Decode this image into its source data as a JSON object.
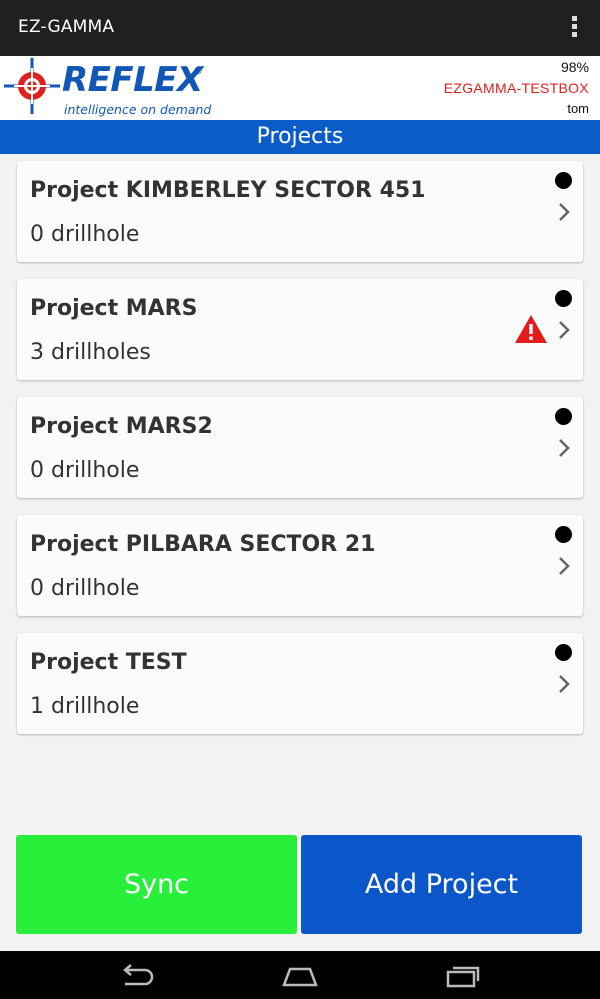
{
  "app": {
    "title": "EZ-GAMMA"
  },
  "brand": {
    "logo_word": "REFLEX",
    "logo_reg": "®",
    "tagline": "intelligence on demand",
    "battery": "98%",
    "device": "EZGAMMA-TESTBOX",
    "user": "tom",
    "colors": {
      "brand_blue": "#1057b6",
      "device_red": "#e0201c"
    }
  },
  "page": {
    "title": "Projects"
  },
  "projects": [
    {
      "name": "Project KIMBERLEY SECTOR 451",
      "count": "0 drillhole",
      "warning": false
    },
    {
      "name": "Project MARS",
      "count": "3 drillholes",
      "warning": true
    },
    {
      "name": "Project MARS2",
      "count": "0 drillhole",
      "warning": false
    },
    {
      "name": "Project PILBARA SECTOR 21",
      "count": "0 drillhole",
      "warning": false
    },
    {
      "name": "Project TEST",
      "count": "1 drillhole",
      "warning": false
    }
  ],
  "buttons": {
    "sync": "Sync",
    "add": "Add Project"
  },
  "colors": {
    "sync": "#28f03a",
    "add": "#0b56c9",
    "titlebar": "#0b5cc9"
  },
  "icons": {
    "overflow": "overflow-menu-icon",
    "warning": "warning-icon",
    "chevron": "chevron-right-icon",
    "status_dot": "status-dot-icon"
  }
}
